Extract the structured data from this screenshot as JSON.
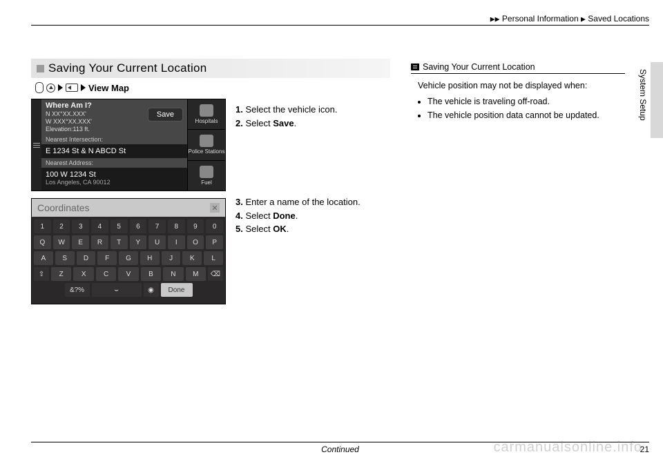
{
  "header": {
    "crumb1": "Personal Information",
    "crumb2": "Saved Locations"
  },
  "side_label": "System Setup",
  "section_title": "Saving Your Current Location",
  "path_label": "View Map",
  "steps1": [
    {
      "n": "1.",
      "t": "Select the vehicle icon."
    },
    {
      "n": "2.",
      "t_pre": "Select ",
      "t_bold": "Save",
      "t_post": "."
    }
  ],
  "steps2": [
    {
      "n": "3.",
      "t": "Enter a name of the location."
    },
    {
      "n": "4.",
      "t_pre": "Select ",
      "t_bold": "Done",
      "t_post": "."
    },
    {
      "n": "5.",
      "t_pre": "Select ",
      "t_bold": "OK",
      "t_post": "."
    }
  ],
  "device1": {
    "title": "Where Am I?",
    "coord1": "N XX°XX.XXX'",
    "coord2": "W XXX°XX.XXX'",
    "elev": "Elevation:113 ft.",
    "save": "Save",
    "nearest_int_label": "Nearest Intersection:",
    "nearest_int": "E 1234 St & N ABCD St",
    "nearest_addr_label": "Nearest Address:",
    "nearest_addr": "100 W 1234 St",
    "nearest_city": "Los Angeles, CA 90012",
    "side": [
      "Hospitals",
      "Police Stations",
      "Fuel"
    ]
  },
  "device2": {
    "input": "Coordinates",
    "row_num": [
      "1",
      "2",
      "3",
      "4",
      "5",
      "6",
      "7",
      "8",
      "9",
      "0"
    ],
    "row1": [
      "Q",
      "W",
      "E",
      "R",
      "T",
      "Y",
      "U",
      "I",
      "O",
      "P"
    ],
    "row2": [
      "A",
      "S",
      "D",
      "F",
      "G",
      "H",
      "J",
      "K",
      "L"
    ],
    "row3": [
      "Z",
      "X",
      "C",
      "V",
      "B",
      "N",
      "M"
    ],
    "sym": "&?%",
    "done": "Done"
  },
  "info": {
    "title": "Saving Your Current Location",
    "intro": "Vehicle position may not be displayed when:",
    "bullets": [
      "The vehicle is traveling off-road.",
      "The vehicle position data cannot be updated."
    ]
  },
  "footer": {
    "continued": "Continued",
    "page": "21"
  },
  "watermark": "carmanualsonline.info"
}
